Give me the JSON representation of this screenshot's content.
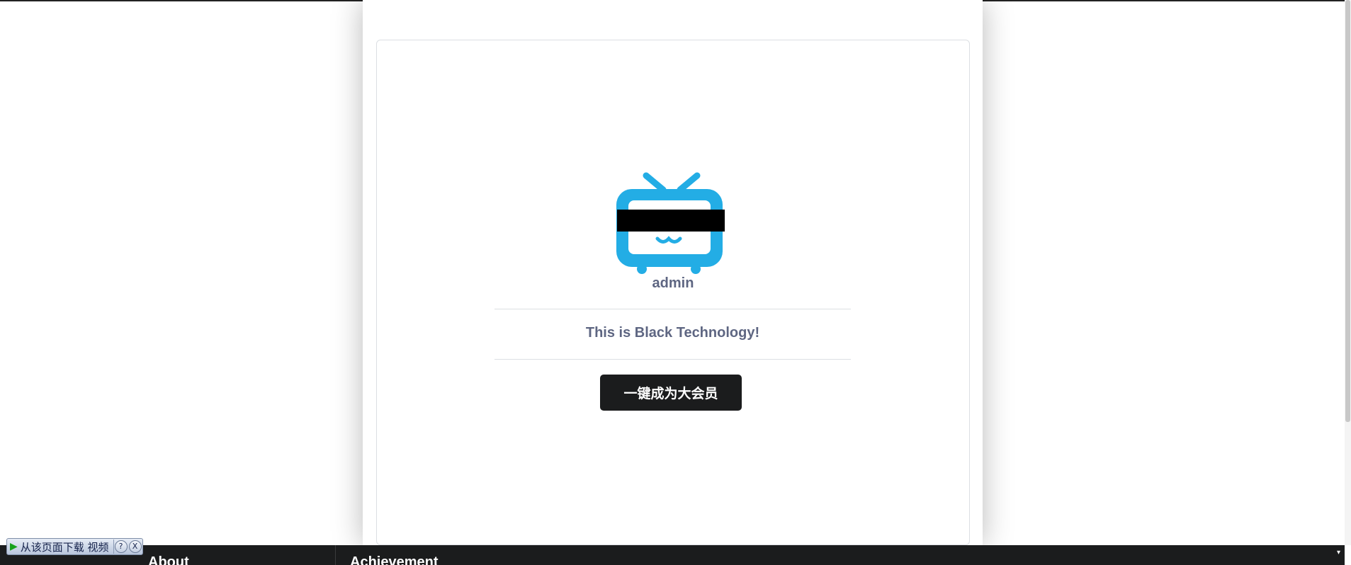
{
  "profile": {
    "username": "admin",
    "bio": "This is Black Technology!",
    "action_label": "一键成为大会员",
    "avatar_icon": "tv-mascot-icon",
    "avatar_color": "#23ade5"
  },
  "footer": {
    "headings": [
      "About",
      "Achievement"
    ]
  },
  "download_toolbar": {
    "label": "从该页面下载 视频",
    "help": "?",
    "close": "X"
  },
  "colors": {
    "button_bg": "#1b1c1d",
    "text_muted": "#5e6682",
    "footer_bg": "#1b1c1d"
  }
}
